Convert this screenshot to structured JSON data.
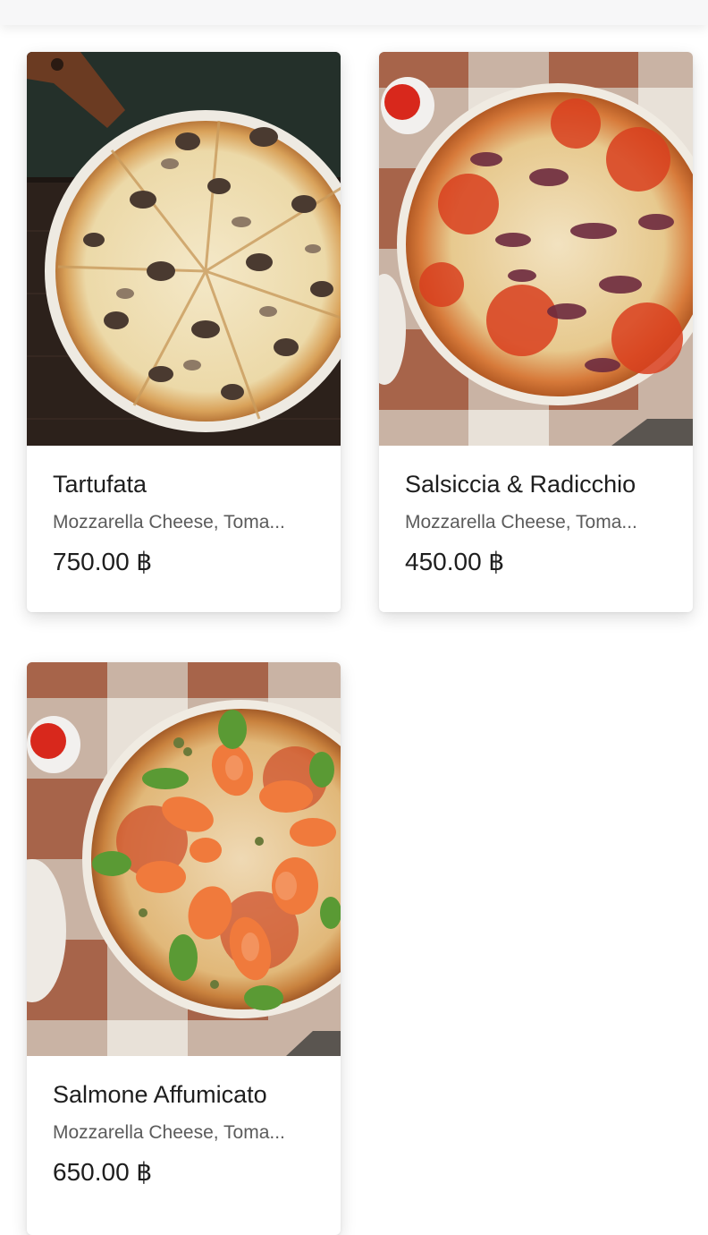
{
  "menu": {
    "items": [
      {
        "name": "Tartufata",
        "description": "Mozzarella Cheese, Toma...",
        "price": "750.00 ฿",
        "image_icon": "pizza-truffle-mushroom-image"
      },
      {
        "name": "Salsiccia & Radicchio",
        "description": "Mozzarella Cheese, Toma...",
        "price": "450.00 ฿",
        "image_icon": "pizza-sausage-radicchio-image"
      },
      {
        "name": "Salmone Affumicato",
        "description": "Mozzarella Cheese, Toma...",
        "price": "650.00 ฿",
        "image_icon": "pizza-smoked-salmon-image"
      }
    ]
  },
  "colors": {
    "text_primary": "#1e1e1e",
    "text_secondary": "#5b5b5b",
    "card_bg": "#ffffff",
    "top_bar_bg": "#f7f7f8"
  }
}
